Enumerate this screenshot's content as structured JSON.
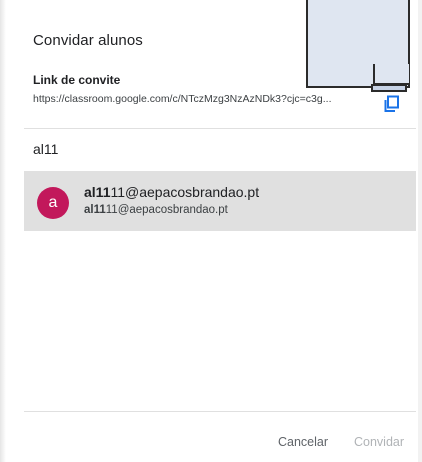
{
  "dialog": {
    "title": "Convidar alunos",
    "invite_link_label": "Link de convite",
    "invite_link_url": "https://classroom.google.com/c/NTczMzg3NzAzNDk3?cjc=c3g...",
    "copy_icon": "copy-icon",
    "search_value": "al11",
    "suggestion": {
      "avatar_letter": "a",
      "avatar_color": "#c2185b",
      "name_match": "al11",
      "name_rest": "11@aepacosbrandao.pt",
      "email_match": "al11",
      "email_rest": "11@aepacosbrandao.pt"
    },
    "cancel_label": "Cancelar",
    "invite_label": "Convidar"
  },
  "colors": {
    "accent_blue": "#1a73e8",
    "selected_row": "#e0e0e0",
    "disabled_text": "#b0b3b6"
  }
}
